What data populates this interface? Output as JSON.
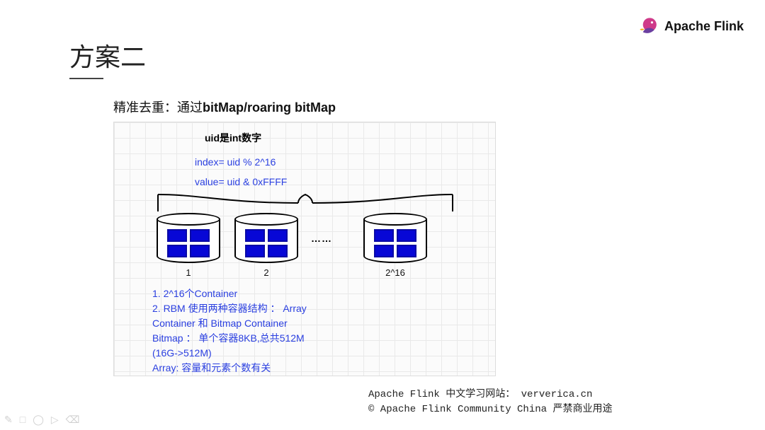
{
  "brand": {
    "name": "Apache Flink"
  },
  "title": "方案二",
  "subtitle_plain": "精准去重：通过",
  "subtitle_bold": "bitMap/roaring bitMap",
  "panel": {
    "uid_label": "uid是int数字",
    "index_formula": "index= uid % 2^16",
    "value_formula": "value= uid &  0xFFFF",
    "dots": "……",
    "barrels": {
      "b1": "1",
      "b2": "2",
      "b3": "2^16"
    },
    "notes": {
      "l1": "1. 2^16个Container",
      "l2": "2. RBM 使用两种容器结构 ： Array",
      "l3": "Container 和 Bitmap Container",
      "l4": "Bitmap ：  单个容器8KB,总共512M",
      "l5": "(16G->512M)",
      "l6": "Array: 容量和元素个数有关"
    }
  },
  "footer": {
    "line1": "Apache Flink 中文学习网站：  ververica.cn",
    "line2": "© Apache Flink Community China  严禁商业用途"
  },
  "chart_data": {
    "type": "table",
    "title": "Roaring Bitmap 方案二示意",
    "rows": [
      {
        "field": "container_count",
        "value": "2^16"
      },
      {
        "field": "index_formula",
        "value": "uid % 2^16"
      },
      {
        "field": "value_formula",
        "value": "uid & 0xFFFF"
      },
      {
        "field": "bitmap_container_size",
        "value": "8KB"
      },
      {
        "field": "bitmap_total_size",
        "value": "512M"
      },
      {
        "field": "original_size_estimate",
        "value": "16G"
      }
    ]
  }
}
